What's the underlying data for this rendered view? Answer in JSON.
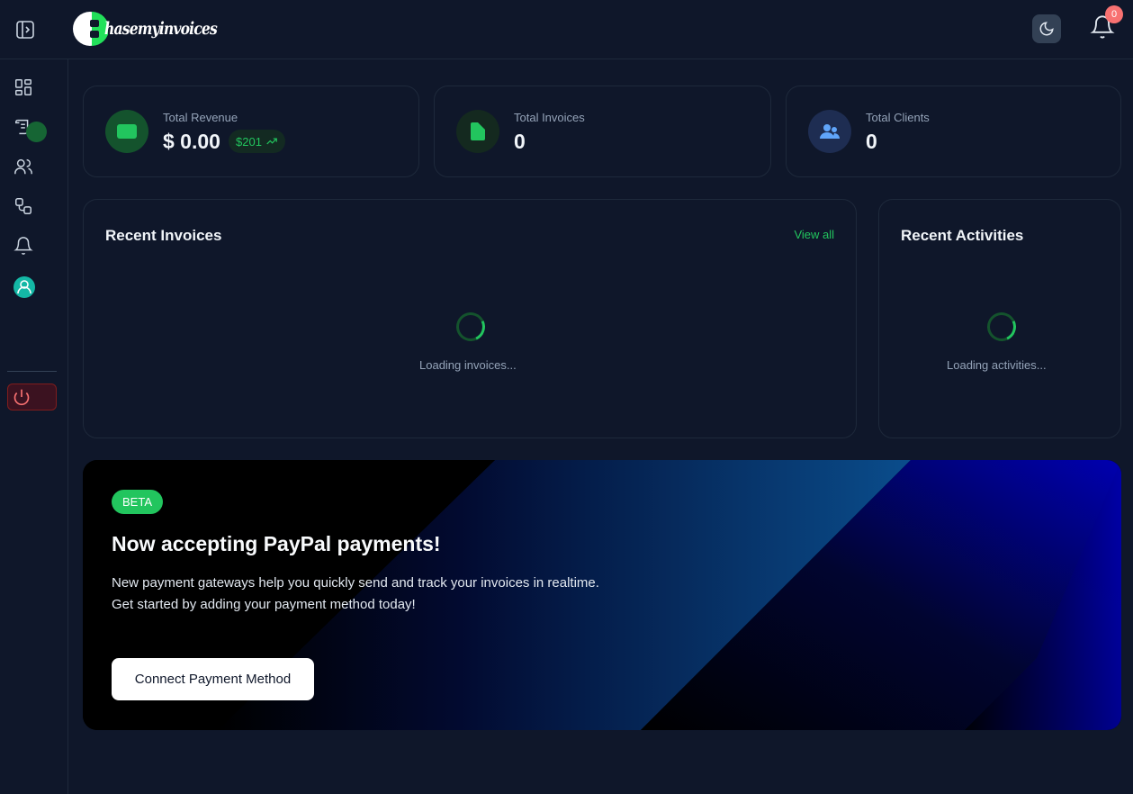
{
  "header": {
    "logo_text": "hasemyinvoices",
    "notification_count": "0"
  },
  "stats": {
    "revenue": {
      "label": "Total Revenue",
      "value": "$ 0.00",
      "trend": "$201"
    },
    "invoices": {
      "label": "Total Invoices",
      "value": "0"
    },
    "clients": {
      "label": "Total Clients",
      "value": "0"
    }
  },
  "recent_invoices": {
    "title": "Recent Invoices",
    "view_all": "View all",
    "loading": "Loading invoices..."
  },
  "recent_activities": {
    "title": "Recent Activities",
    "loading": "Loading activities..."
  },
  "promo": {
    "badge": "BETA",
    "title": "Now accepting PayPal payments!",
    "line1": "New payment gateways help you quickly send and track your invoices in realtime.",
    "line2": "Get started by adding your payment method today!",
    "button": "Connect Payment Method"
  },
  "colors": {
    "accent": "#22c55e",
    "background": "#0f172a",
    "danger": "#f87171",
    "promo_blue": "#0000b0"
  }
}
